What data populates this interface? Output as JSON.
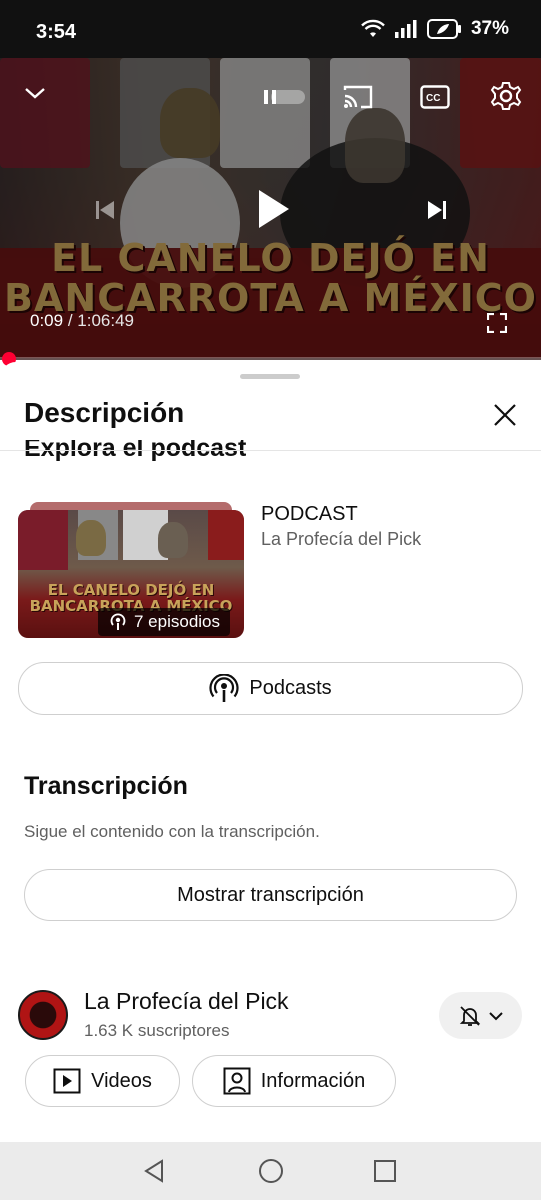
{
  "status_bar": {
    "time": "3:54",
    "battery": "37%",
    "icons": [
      "wifi-icon",
      "signal-icon",
      "battery-icon"
    ]
  },
  "player": {
    "video_title_overlay": "EL CANELO DEJÓ EN BANCARROTA A MÉXICO",
    "current_time": "0:09",
    "duration": "1:06:49",
    "progress_fraction": 0.002,
    "controls": [
      "collapse-icon",
      "autoplay-toggle",
      "cast-icon",
      "captions-icon",
      "settings-icon",
      "previous-icon",
      "play-icon",
      "next-icon",
      "fullscreen-icon"
    ]
  },
  "sheet": {
    "title": "Descripción",
    "cut_heading": "Explora el podcast",
    "podcast": {
      "type": "PODCAST",
      "channel": "La Profecía del Pick",
      "thumbnail_text": "EL CANELO DEJÓ EN BANCARROTA A MÉXICO",
      "episodes_badge": "7 episodios"
    },
    "podcasts_button": "Podcasts",
    "transcript": {
      "title": "Transcripción",
      "subtitle": "Sigue el contenido con la transcripción.",
      "button": "Mostrar transcripción"
    },
    "channel": {
      "name": "La Profecía del Pick",
      "subscribers": "1.63 K suscriptores",
      "videos_button": "Videos",
      "info_button": "Información"
    }
  },
  "colors": {
    "accent_red": "#ff0033",
    "text_primary": "#0f0f0f",
    "text_secondary": "#606060",
    "banner_red": "#6c1414",
    "banner_gold": "#c8a35a"
  }
}
